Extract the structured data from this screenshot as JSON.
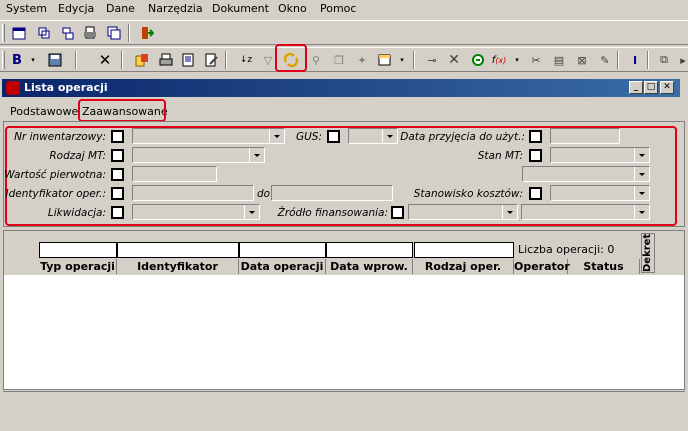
{
  "menu": [
    "System",
    "Edycja",
    "Dane",
    "Narzędzia",
    "Dokument",
    "Okno",
    "Pomoc"
  ],
  "window": {
    "title": "Lista operacji"
  },
  "tabs": [
    {
      "label": "Podstawowe",
      "active": false
    },
    {
      "label": "Zaawansowane",
      "active": true
    }
  ],
  "filters": {
    "nr_inwentarzowy": "Nr inwentarzowy:",
    "gus": "GUS:",
    "data_przyjecia": "Data przyjęcia do użyt.:",
    "rodzaj_mt": "Rodzaj MT:",
    "stan_mt": "Stan MT:",
    "wartosc_pierwotna": "Wartość pierwotna:",
    "identyfikator_oper": "Identyfikator oper.:",
    "do": "do",
    "stanowisko_kosztow": "Stanowisko kosztów:",
    "likwidacja": "Likwidacja:",
    "zrodlo_finansowania": "Źródło finansowania:"
  },
  "grid": {
    "count_text": "Liczba operacji: 0",
    "columns": [
      "Typ operacji",
      "Identyfikator",
      "Data operacji",
      "Data wprow.",
      "Rodzaj oper.",
      "Operator",
      "Status"
    ],
    "dekret": "Dekret"
  },
  "colors": {
    "highlight": "#e0001a",
    "title_start": "#0a246a",
    "title_end": "#3a6ea5"
  }
}
